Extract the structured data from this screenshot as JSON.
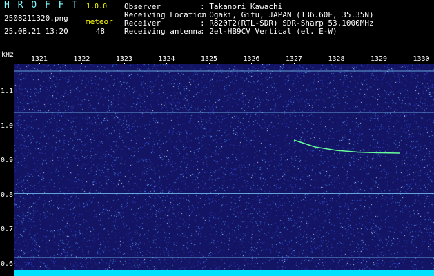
{
  "header": {
    "app_title": "H R O F F T",
    "app_version": "1.0.0",
    "file_name": "2508211320.png",
    "datetime": "25.08.21 13:20",
    "event_label": "meteor",
    "event_count": "48",
    "info": [
      {
        "label": "Observer",
        "value": ": Takanori Kawachi"
      },
      {
        "label": "Receiving Location",
        "value": ": Ogaki, Gifu, JAPAN (136.60E, 35.35N)"
      },
      {
        "label": "Receiver",
        "value": ": R820T2(RTL-SDR) SDR-Sharp 53.1000MHz"
      },
      {
        "label": "Receiving antenna",
        "value": ": 2el-HB9CV Vertical (el. E-W)"
      }
    ]
  },
  "chart_data": {
    "type": "heatmap",
    "ylabel": "kHz",
    "x_ticks": [
      "1321",
      "1322",
      "1323",
      "1324",
      "1325",
      "1326",
      "1327",
      "1328",
      "1329",
      "1330"
    ],
    "y_ticks": [
      "1.1",
      "1.0",
      "0.9",
      "0.8",
      "0.7",
      "0.6"
    ],
    "xlim": [
      1320.4,
      1330.3
    ],
    "ylim": [
      0.58,
      1.18
    ],
    "colors": {
      "background": "#141464",
      "carrier": "#7fd0ff",
      "meteor": "#66ff99",
      "bottom_strip": "#00e0ff"
    },
    "carriers_khz": [
      1.16,
      1.04,
      0.925,
      0.805,
      0.62
    ],
    "meteor_trace": {
      "x": [
        1327.0,
        1327.5,
        1328.0,
        1328.5,
        1329.0,
        1329.5
      ],
      "y": [
        0.96,
        0.94,
        0.93,
        0.925,
        0.923,
        0.922
      ]
    }
  }
}
